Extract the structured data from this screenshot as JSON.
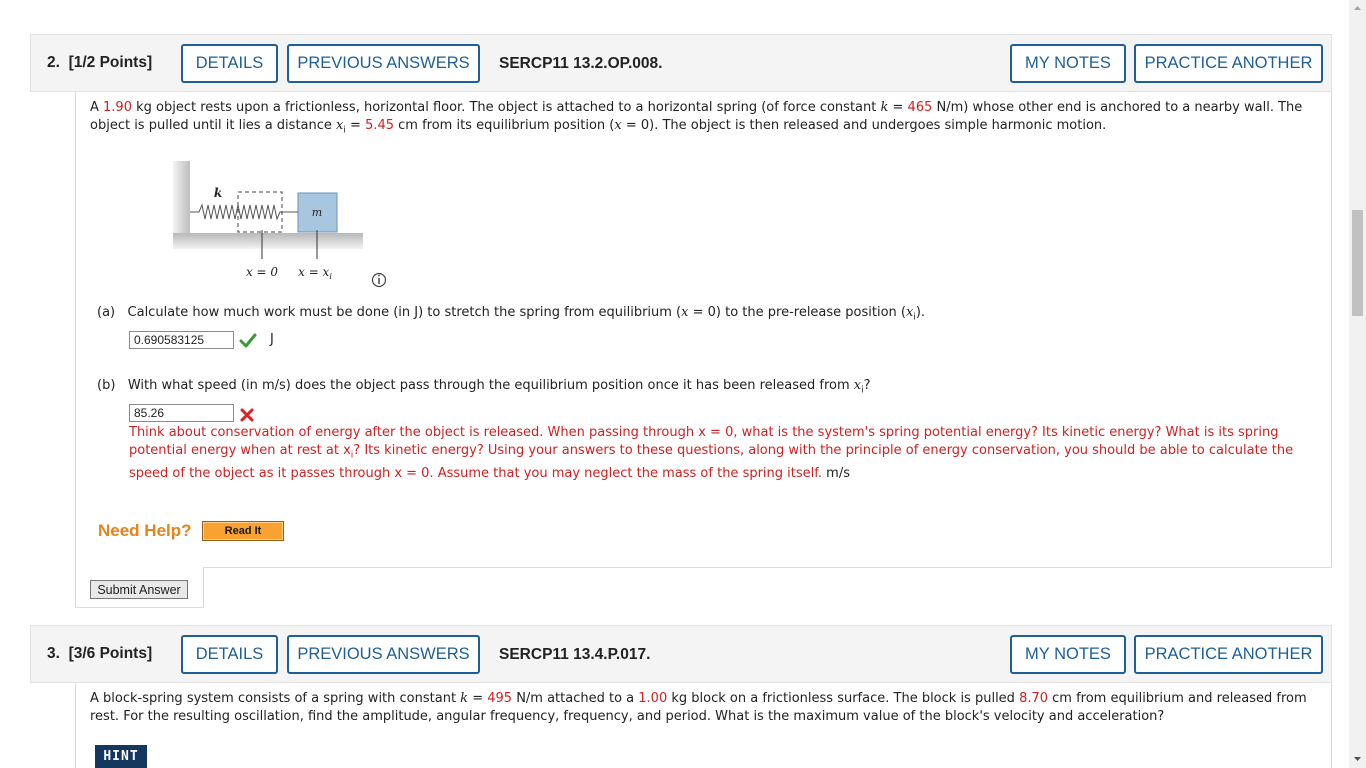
{
  "q2": {
    "number": "2.",
    "points": "[1/2 Points]",
    "details": "DETAILS",
    "previous_answers": "PREVIOUS ANSWERS",
    "code": "SERCP11 13.2.OP.008.",
    "my_notes": "MY NOTES",
    "practice_another": "PRACTICE ANOTHER",
    "stmt": {
      "a1": "A ",
      "mass": "1.90",
      "a2": " kg object rests upon a frictionless, horizontal floor. The object is attached to a horizontal spring (of force constant ",
      "k_sym": "k",
      "eq": " = ",
      "k_val": "465",
      "a3": " N/m) whose other end is anchored to a nearby wall. The",
      "b1": "object is pulled until it lies a distance ",
      "x_sym": "x",
      "i_sub": "i",
      "b2": " = ",
      "dist": "5.45",
      "b3": " cm from its equilibrium position (",
      "x0_sym": "x",
      "b4": " = 0). The object is then released and undergoes simple harmonic motion."
    },
    "figure": {
      "k_label": "k",
      "m_label": "m",
      "x0_label": "x = 0",
      "xi_label": "x = x",
      "xi_sub": "i",
      "info_icon": "info-circle-icon"
    },
    "part_a": {
      "label": "(a)",
      "q1": "Calculate how much work must be done (in J) to stretch the spring from equilibrium (",
      "x_sym": "x",
      "q2": " = 0) to the pre-release position (",
      "x2_sym": "x",
      "i_sub": "i",
      "q3": ").",
      "answer": "0.690583125",
      "unit": "J",
      "status_icon": "check-icon"
    },
    "part_b": {
      "label": "(b)",
      "q1": "With what speed (in m/s) does the object pass through the equilibrium position once it has been released from ",
      "x_sym": "x",
      "i_sub": "i",
      "q2": "?",
      "answer": "85.26",
      "status_icon": "x-icon",
      "fb1": "Think about conservation of energy after the object is released. When passing through x = 0, what is the system's spring potential energy? Its kinetic energy? What is its spring",
      "fb2a": "potential energy when at rest at x",
      "fb2_sub": "i",
      "fb2b": "? Its kinetic energy? Using your answers to these questions, along with the principle of energy conservation, you should be able to calculate the",
      "fb3": "speed of the object as it passes through x = 0. Assume that you may neglect the mass of the spring itself.",
      "unit": " m/s"
    },
    "need_help": "Need Help?",
    "read_it": "Read It",
    "submit": "Submit Answer"
  },
  "q3": {
    "number": "3.",
    "points": "[3/6 Points]",
    "details": "DETAILS",
    "previous_answers": "PREVIOUS ANSWERS",
    "code": "SERCP11 13.4.P.017.",
    "my_notes": "MY NOTES",
    "practice_another": "PRACTICE ANOTHER",
    "stmt": {
      "a1": "A block-spring system consists of a spring with constant ",
      "k_sym": "k",
      "eq": " = ",
      "k_val": "495",
      "a2": " N/m attached to a ",
      "mass": "1.00",
      "a3": " kg block on a frictionless surface. The block is pulled ",
      "dist": "8.70",
      "a4": " cm from equilibrium and released from",
      "b1": "rest. For the resulting oscillation, find the amplitude, angular frequency, frequency, and period. What is the maximum value of the block's velocity and acceleration?"
    },
    "hint": "HINT"
  },
  "colors": {
    "accent_blue": "#1d5f96",
    "value_red": "#cc2222",
    "need_help_orange": "#e5831c",
    "read_it_orange": "#f7a231"
  }
}
